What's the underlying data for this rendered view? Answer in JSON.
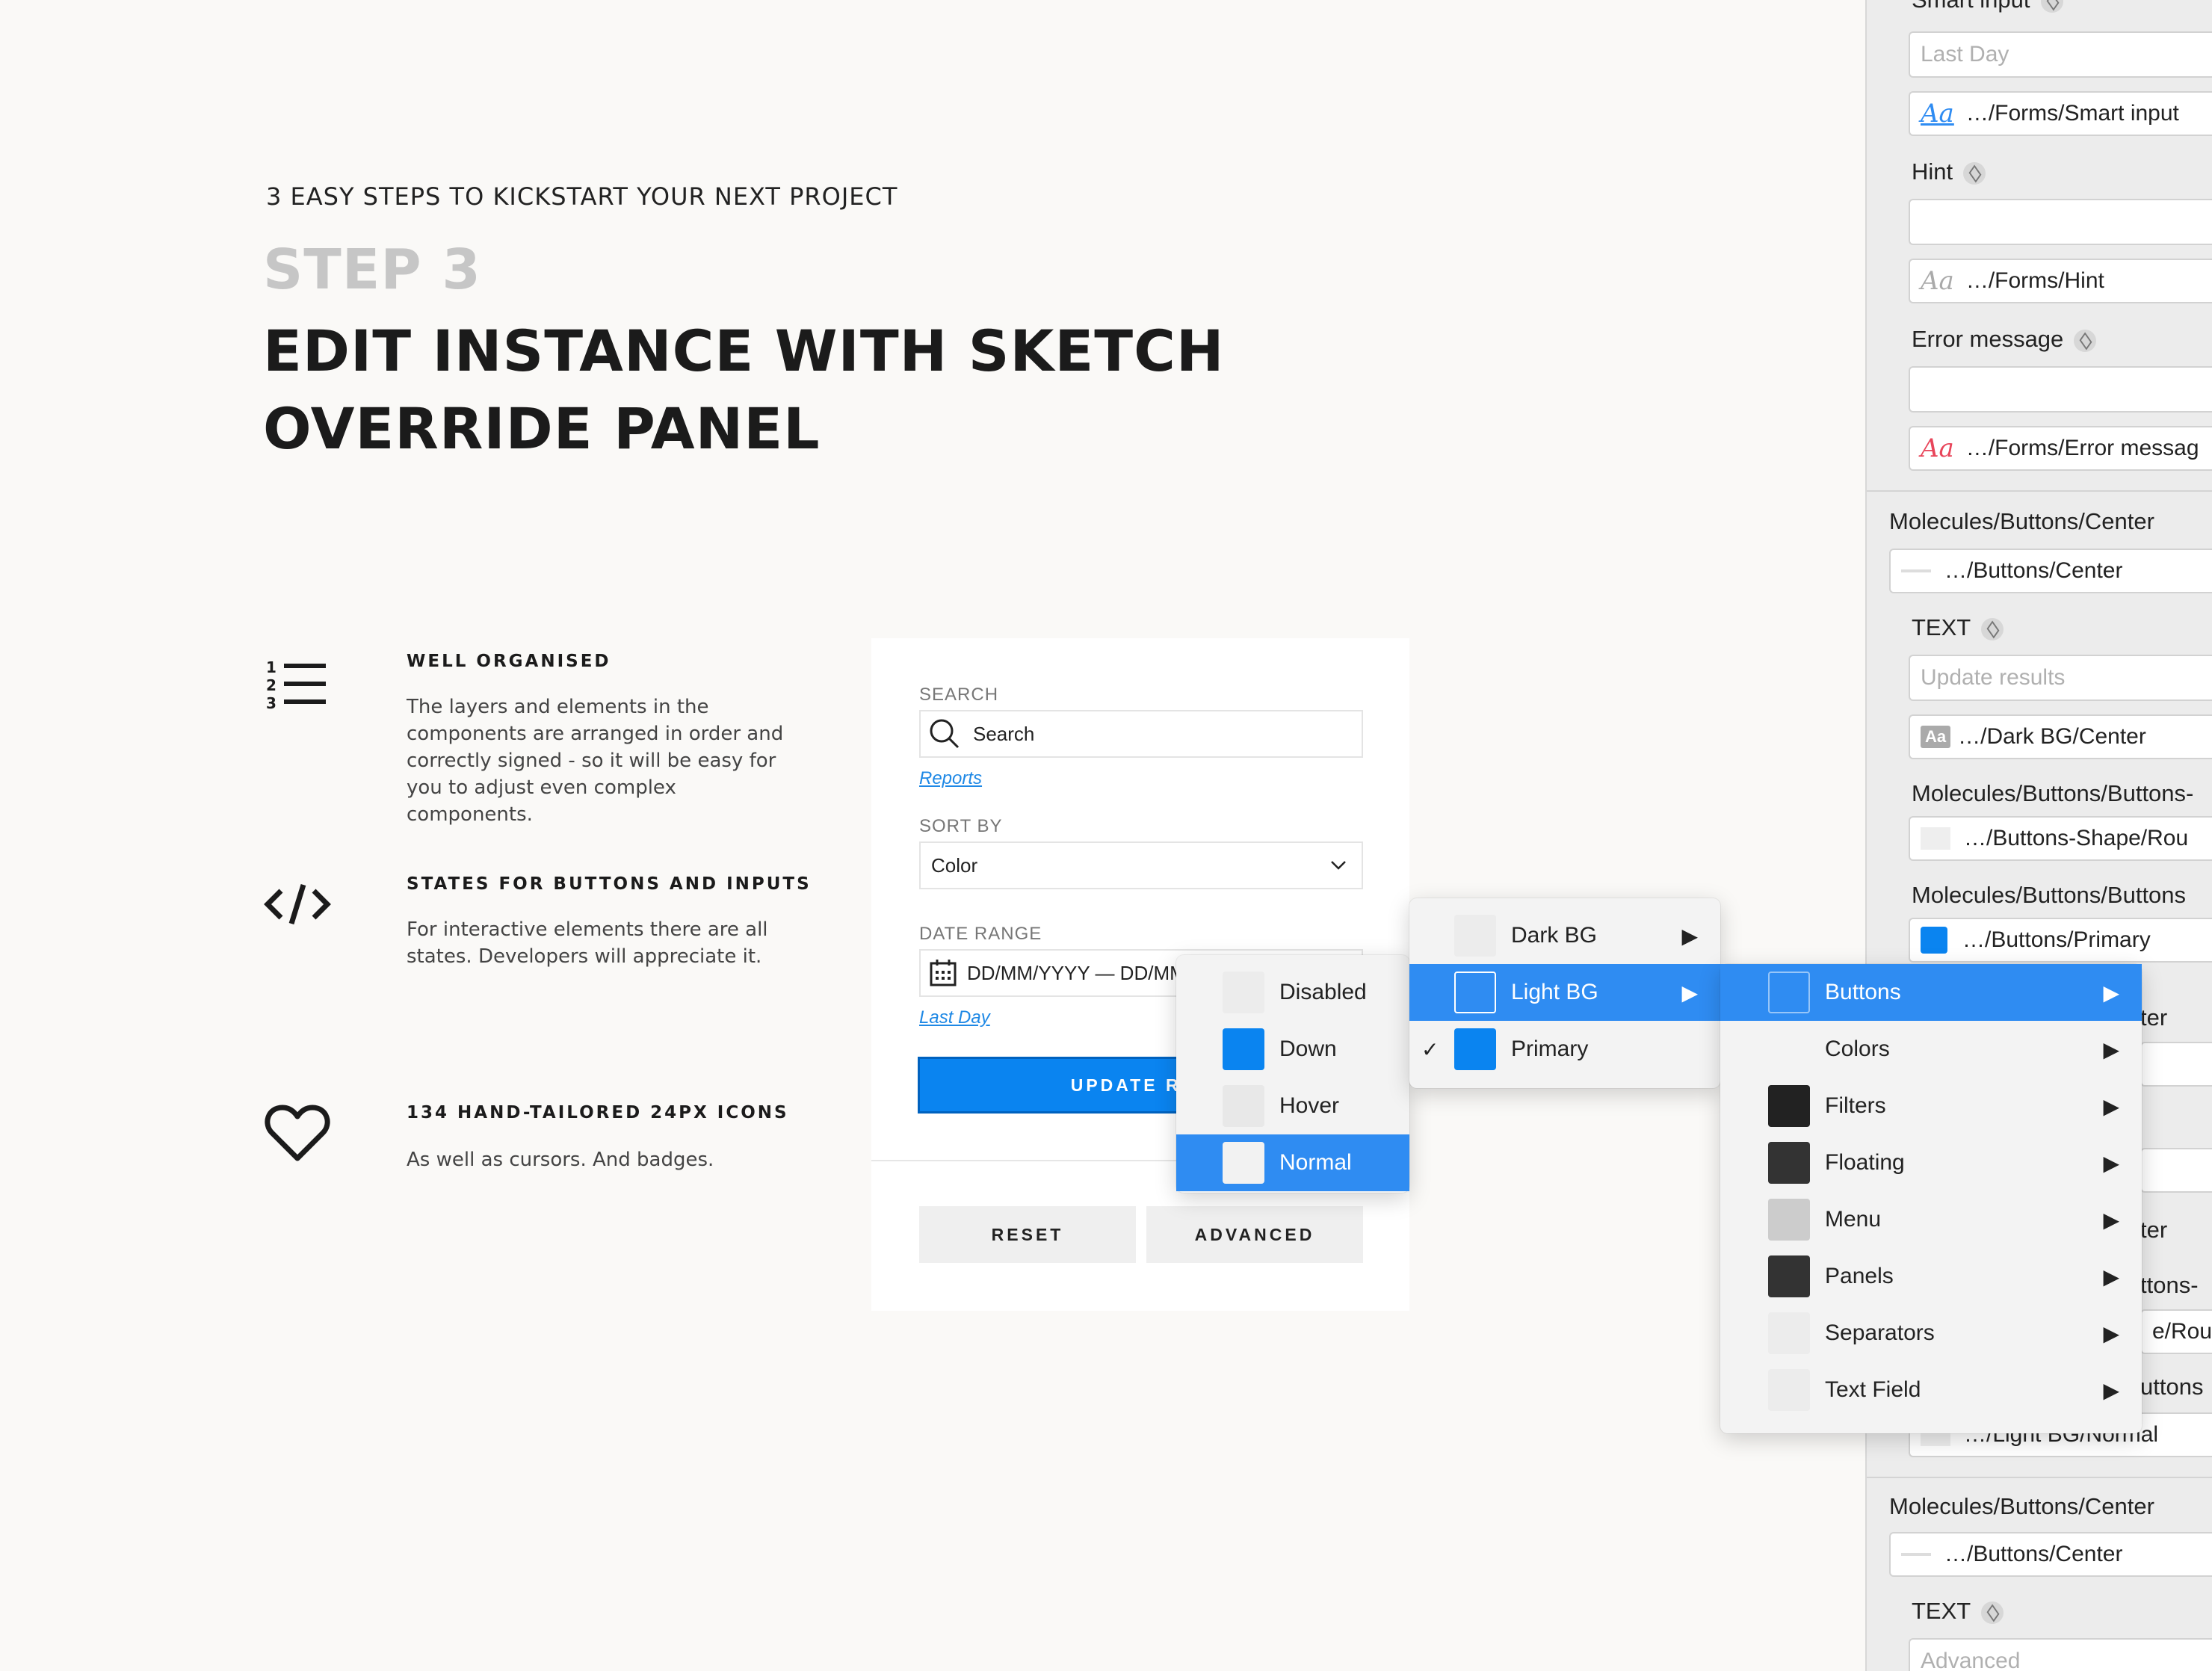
{
  "hero": {
    "kicker": "3 EASY STEPS TO KICKSTART YOUR NEXT PROJECT",
    "step": "STEP 3",
    "headline_line1": "EDIT INSTANCE WITH SKETCH",
    "headline_line2": "OVERRIDE PANEL"
  },
  "features": [
    {
      "title": "WELL ORGANISED",
      "text": "The layers and elements in the components are arranged in order and correctly signed - so it will be easy for you to adjust even complex components.",
      "icon": "numbered-list-icon"
    },
    {
      "title": "STATES FOR BUTTONS AND INPUTS",
      "text": "For interactive elements there are all states. Developers will appreciate it.",
      "icon": "code-icon"
    },
    {
      "title": "134 HAND-TAILORED 24PX ICONS",
      "text": "As well as cursors. And badges.",
      "icon": "heart-icon"
    }
  ],
  "form": {
    "search_label": "SEARCH",
    "search_value": "Search",
    "reports_link": "Reports",
    "sort_label": "SORT BY",
    "sort_value": "Color",
    "date_label": "DATE RANGE",
    "date_value": "DD/MM/YYYY — DD/MM",
    "last_day_link": "Last Day",
    "update_button": "UPDATE RES",
    "reset_button": "RESET",
    "advanced_button": "ADVANCED"
  },
  "menu_states": {
    "items": [
      {
        "label": "Disabled",
        "swatch": "#ececec"
      },
      {
        "label": "Down",
        "swatch": "#0a84f0"
      },
      {
        "label": "Hover",
        "swatch": "#e8e8e8"
      },
      {
        "label": "Normal",
        "swatch": "#f2f2f2"
      }
    ]
  },
  "menu_bg": {
    "items": [
      {
        "label": "Dark BG",
        "swatch": "#ececec",
        "arrow": "▶"
      },
      {
        "label": "Light BG",
        "swatch": "#2f8cf2",
        "arrow": "▶"
      },
      {
        "label": "Primary",
        "swatch": "#0a84f0",
        "check": "✓"
      }
    ]
  },
  "menu_categories": {
    "items": [
      {
        "label": "Buttons",
        "swatch": "#2f8cf2",
        "arrow": "▶"
      },
      {
        "label": "Colors",
        "swatch": "transparent",
        "arrow": "▶"
      },
      {
        "label": "Filters",
        "swatch": "#222222",
        "arrow": "▶"
      },
      {
        "label": "Floating",
        "swatch": "#333333",
        "arrow": "▶"
      },
      {
        "label": "Menu",
        "swatch": "#cccccc",
        "arrow": "▶"
      },
      {
        "label": "Panels",
        "swatch": "#333333",
        "arrow": "▶"
      },
      {
        "label": "Separators",
        "swatch": "#ececec",
        "arrow": "▶"
      },
      {
        "label": "Text Field",
        "swatch": "#ececec",
        "arrow": "▶"
      }
    ]
  },
  "panel": {
    "smart_input_title": "Smart input",
    "smart_input_placeholder": "Last Day",
    "smart_input_style": "…/Forms/Smart input",
    "hint_title": "Hint",
    "hint_style": "…/Forms/Hint",
    "error_title": "Error message",
    "error_style": "…/Forms/Error messag",
    "center_group1": "Molecules/Buttons/Center",
    "center_value1": "…/Buttons/Center",
    "text_title1": "TEXT",
    "text_placeholder1": "Update results",
    "text_style1": "…/Dark BG/Center",
    "shape_group": "Molecules/Buttons/Buttons-",
    "shape_value": "…/Buttons-Shape/Rou",
    "primary_group": "Molecules/Buttons/Buttons",
    "primary_value": "…/Buttons/Primary",
    "partial_ter1": "ter",
    "partial_ter2": "ter",
    "partial_ttons": "ttons-",
    "partial_round": "e/Rou",
    "partial_uttons": "uttons",
    "partial_normal": "…/Light BG/Normal",
    "center_group2": "Molecules/Buttons/Center",
    "center_value2": "…/Buttons/Center",
    "text_title2": "TEXT",
    "text_placeholder2": "Advanced",
    "aa_label": "Aa"
  },
  "colors": {
    "accent": "#2f8cf2",
    "primary_button": "#0a84f0",
    "error": "#e8455a",
    "link": "#1e88e5"
  }
}
